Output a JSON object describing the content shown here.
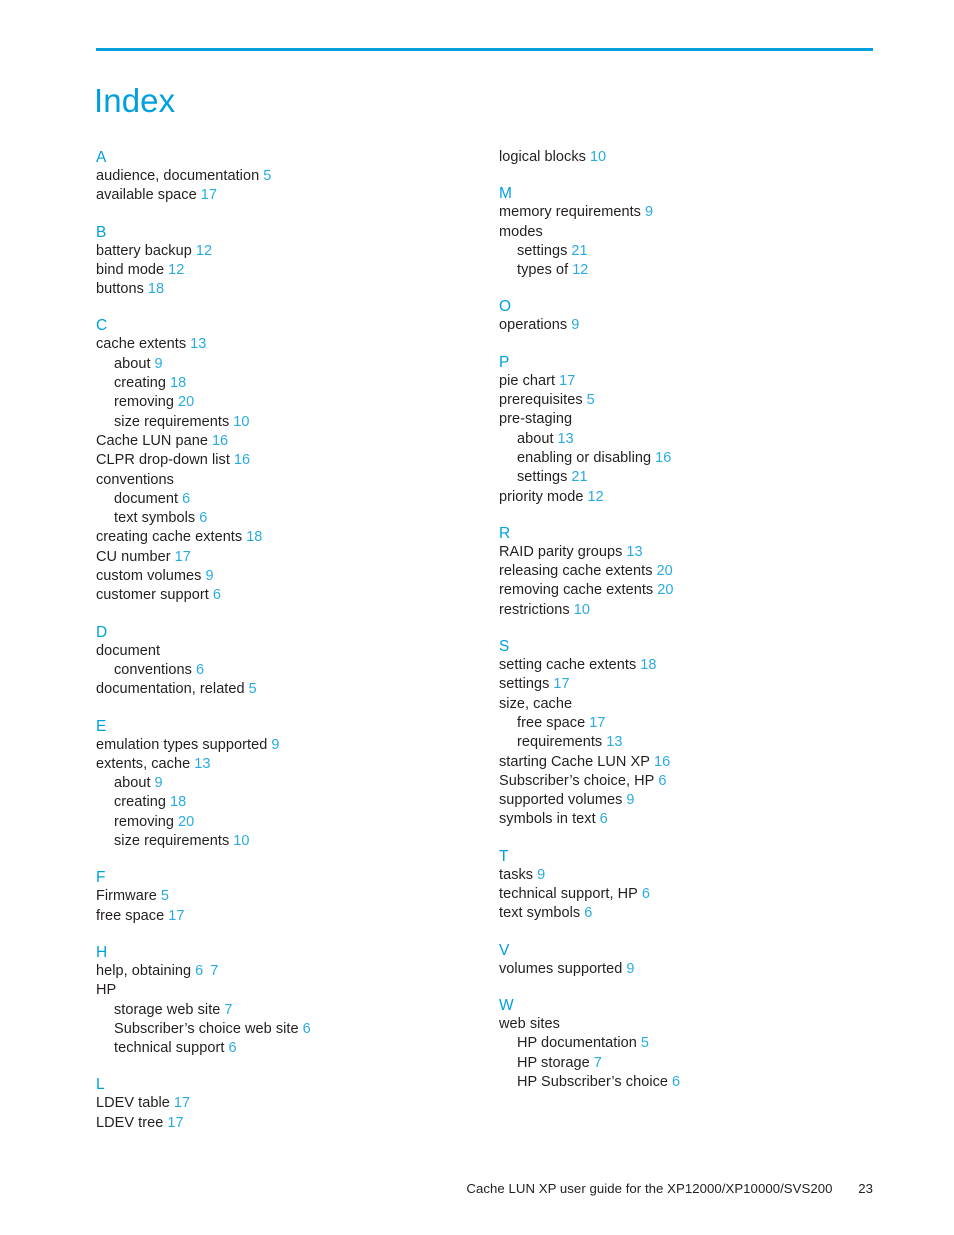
{
  "document": {
    "title": "Index",
    "accent_color": "#00a0dc",
    "page_number_color": "#29abe2",
    "text_color": "#231f20"
  },
  "footer": {
    "guide_title": "Cache LUN XP user guide for the XP12000/XP10000/SVS200",
    "page_number": "23"
  },
  "columns": {
    "left": {
      "continued": [],
      "sections": [
        {
          "letter": "A",
          "entries": [
            {
              "label": "audience, documentation",
              "pages": [
                "5"
              ],
              "level": 0
            },
            {
              "label": "available space",
              "pages": [
                "17"
              ],
              "level": 0
            }
          ]
        },
        {
          "letter": "B",
          "entries": [
            {
              "label": "battery backup",
              "pages": [
                "12"
              ],
              "level": 0
            },
            {
              "label": "bind mode",
              "pages": [
                "12"
              ],
              "level": 0
            },
            {
              "label": "buttons",
              "pages": [
                "18"
              ],
              "level": 0
            }
          ]
        },
        {
          "letter": "C",
          "entries": [
            {
              "label": "cache extents",
              "pages": [
                "13"
              ],
              "level": 0
            },
            {
              "label": "about",
              "pages": [
                "9"
              ],
              "level": 1
            },
            {
              "label": "creating",
              "pages": [
                "18"
              ],
              "level": 1
            },
            {
              "label": "removing",
              "pages": [
                "20"
              ],
              "level": 1
            },
            {
              "label": "size requirements",
              "pages": [
                "10"
              ],
              "level": 1
            },
            {
              "label": "Cache LUN pane",
              "pages": [
                "16"
              ],
              "level": 0
            },
            {
              "label": "CLPR drop-down list",
              "pages": [
                "16"
              ],
              "level": 0
            },
            {
              "label": "conventions",
              "pages": [],
              "level": 0
            },
            {
              "label": "document",
              "pages": [
                "6"
              ],
              "level": 1
            },
            {
              "label": "text symbols",
              "pages": [
                "6"
              ],
              "level": 1
            },
            {
              "label": "creating cache extents",
              "pages": [
                "18"
              ],
              "level": 0
            },
            {
              "label": "CU number",
              "pages": [
                "17"
              ],
              "level": 0
            },
            {
              "label": "custom volumes",
              "pages": [
                "9"
              ],
              "level": 0
            },
            {
              "label": "customer support",
              "pages": [
                "6"
              ],
              "level": 0
            }
          ]
        },
        {
          "letter": "D",
          "entries": [
            {
              "label": "document",
              "pages": [],
              "level": 0
            },
            {
              "label": "conventions",
              "pages": [
                "6"
              ],
              "level": 1
            },
            {
              "label": "documentation, related",
              "pages": [
                "5"
              ],
              "level": 0
            }
          ]
        },
        {
          "letter": "E",
          "entries": [
            {
              "label": "emulation types supported",
              "pages": [
                "9"
              ],
              "level": 0
            },
            {
              "label": "extents, cache",
              "pages": [
                "13"
              ],
              "level": 0
            },
            {
              "label": "about",
              "pages": [
                "9"
              ],
              "level": 1
            },
            {
              "label": "creating",
              "pages": [
                "18"
              ],
              "level": 1
            },
            {
              "label": "removing",
              "pages": [
                "20"
              ],
              "level": 1
            },
            {
              "label": "size requirements",
              "pages": [
                "10"
              ],
              "level": 1
            }
          ]
        },
        {
          "letter": "F",
          "entries": [
            {
              "label": "Firmware",
              "pages": [
                "5"
              ],
              "level": 0
            },
            {
              "label": "free space",
              "pages": [
                "17"
              ],
              "level": 0
            }
          ]
        },
        {
          "letter": "H",
          "entries": [
            {
              "label": "help, obtaining",
              "pages": [
                "6",
                "7"
              ],
              "level": 0
            },
            {
              "label": "HP",
              "pages": [],
              "level": 0
            },
            {
              "label": "storage web site",
              "pages": [
                "7"
              ],
              "level": 1
            },
            {
              "label": "Subscriber’s choice web site",
              "pages": [
                "6"
              ],
              "level": 1
            },
            {
              "label": "technical support",
              "pages": [
                "6"
              ],
              "level": 1
            }
          ]
        },
        {
          "letter": "L",
          "entries": [
            {
              "label": "LDEV table",
              "pages": [
                "17"
              ],
              "level": 0
            },
            {
              "label": "LDEV tree",
              "pages": [
                "17"
              ],
              "level": 0
            }
          ]
        }
      ]
    },
    "right": {
      "continued": [
        {
          "label": "logical blocks",
          "pages": [
            "10"
          ],
          "level": 0
        }
      ],
      "sections": [
        {
          "letter": "M",
          "entries": [
            {
              "label": "memory requirements",
              "pages": [
                "9"
              ],
              "level": 0
            },
            {
              "label": "modes",
              "pages": [],
              "level": 0
            },
            {
              "label": "settings",
              "pages": [
                "21"
              ],
              "level": 1
            },
            {
              "label": "types of",
              "pages": [
                "12"
              ],
              "level": 1
            }
          ]
        },
        {
          "letter": "O",
          "entries": [
            {
              "label": "operations",
              "pages": [
                "9"
              ],
              "level": 0
            }
          ]
        },
        {
          "letter": "P",
          "entries": [
            {
              "label": "pie chart",
              "pages": [
                "17"
              ],
              "level": 0
            },
            {
              "label": "prerequisites",
              "pages": [
                "5"
              ],
              "level": 0
            },
            {
              "label": "pre-staging",
              "pages": [],
              "level": 0
            },
            {
              "label": "about",
              "pages": [
                "13"
              ],
              "level": 1
            },
            {
              "label": "enabling or disabling",
              "pages": [
                "16"
              ],
              "level": 1
            },
            {
              "label": "settings",
              "pages": [
                "21"
              ],
              "level": 1
            },
            {
              "label": "priority mode",
              "pages": [
                "12"
              ],
              "level": 0
            }
          ]
        },
        {
          "letter": "R",
          "entries": [
            {
              "label": "RAID parity groups",
              "pages": [
                "13"
              ],
              "level": 0
            },
            {
              "label": "releasing cache extents",
              "pages": [
                "20"
              ],
              "level": 0
            },
            {
              "label": "removing cache extents",
              "pages": [
                "20"
              ],
              "level": 0
            },
            {
              "label": "restrictions",
              "pages": [
                "10"
              ],
              "level": 0
            }
          ]
        },
        {
          "letter": "S",
          "entries": [
            {
              "label": "setting cache extents",
              "pages": [
                "18"
              ],
              "level": 0
            },
            {
              "label": "settings",
              "pages": [
                "17"
              ],
              "level": 0
            },
            {
              "label": "size, cache",
              "pages": [],
              "level": 0
            },
            {
              "label": "free space",
              "pages": [
                "17"
              ],
              "level": 1
            },
            {
              "label": "requirements",
              "pages": [
                "13"
              ],
              "level": 1
            },
            {
              "label": "starting Cache LUN XP",
              "pages": [
                "16"
              ],
              "level": 0
            },
            {
              "label": "Subscriber’s choice, HP",
              "pages": [
                "6"
              ],
              "level": 0
            },
            {
              "label": "supported volumes",
              "pages": [
                "9"
              ],
              "level": 0
            },
            {
              "label": "symbols in text",
              "pages": [
                "6"
              ],
              "level": 0
            }
          ]
        },
        {
          "letter": "T",
          "entries": [
            {
              "label": "tasks",
              "pages": [
                "9"
              ],
              "level": 0
            },
            {
              "label": "technical support, HP",
              "pages": [
                "6"
              ],
              "level": 0
            },
            {
              "label": "text symbols",
              "pages": [
                "6"
              ],
              "level": 0
            }
          ]
        },
        {
          "letter": "V",
          "entries": [
            {
              "label": "volumes supported",
              "pages": [
                "9"
              ],
              "level": 0
            }
          ]
        },
        {
          "letter": "W",
          "entries": [
            {
              "label": "web sites",
              "pages": [],
              "level": 0
            },
            {
              "label": "HP documentation",
              "pages": [
                "5"
              ],
              "level": 1
            },
            {
              "label": "HP storage",
              "pages": [
                "7"
              ],
              "level": 1
            },
            {
              "label": "HP Subscriber’s choice",
              "pages": [
                "6"
              ],
              "level": 1
            }
          ]
        }
      ]
    }
  }
}
